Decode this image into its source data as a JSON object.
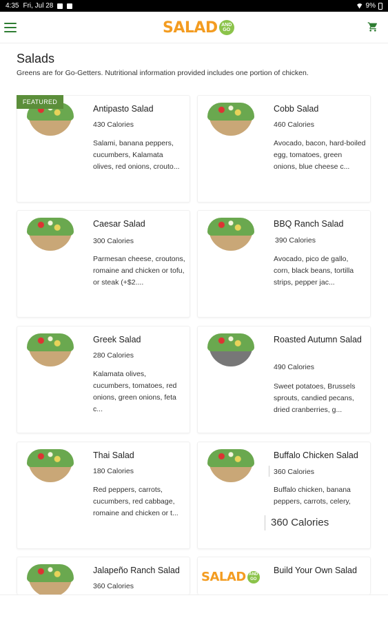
{
  "status_bar": {
    "time": "4:35",
    "date": "Fri, Jul 28",
    "battery": "9%"
  },
  "header": {
    "logo_text": "SALAD",
    "logo_badge": "AND GO"
  },
  "page": {
    "title": "Salads",
    "description": "Greens are for Go-Getters. Nutritional information provided includes one portion of chicken."
  },
  "featured_label": "FEATURED",
  "items": [
    {
      "name": "Antipasto Salad",
      "calories": "430 Calories",
      "description": "Salami, banana peppers, cucumbers, Kalamata olives, red onions, crouto..."
    },
    {
      "name": "Cobb Salad",
      "calories": "460 Calories",
      "description": "Avocado, bacon, hard-boiled egg, tomatoes, green onions, blue cheese c..."
    },
    {
      "name": "Caesar Salad",
      "calories": "300 Calories",
      "description": "Parmesan cheese, croutons, romaine and chicken or tofu, or steak (+$2...."
    },
    {
      "name": "BBQ Ranch Salad",
      "calories": "390 Calories",
      "description": "Avocado, pico de gallo, corn, black beans, tortilla strips, pepper jac..."
    },
    {
      "name": "Greek Salad",
      "calories": "280 Calories",
      "description": "Kalamata olives, cucumbers, tomatoes, red onions, green onions, feta c..."
    },
    {
      "name": "Roasted Autumn Salad",
      "calories": "490 Calories",
      "description": "Sweet potatoes, Brussels sprouts, candied pecans, dried cranberries, g..."
    },
    {
      "name": "Thai Salad",
      "calories": "180 Calories",
      "description": "Red peppers, carrots, cucumbers, red cabbage, romaine and chicken or t..."
    },
    {
      "name": "Buffalo Chicken Salad",
      "calories": "360 Calories",
      "description": "Buffalo chicken, banana peppers, carrots, celery,"
    },
    {
      "name": "Jalapeño Ranch Salad",
      "calories": "360 Calories",
      "description": ""
    },
    {
      "name": "Build Your Own Salad",
      "calories": "",
      "description": ""
    }
  ],
  "tooltip_calories": "360 Calories",
  "colors": {
    "brand_green": "#2e7d32",
    "logo_orange": "#f39c21",
    "logo_badge_green": "#8bc34a",
    "featured_green": "#5b8e3a"
  }
}
